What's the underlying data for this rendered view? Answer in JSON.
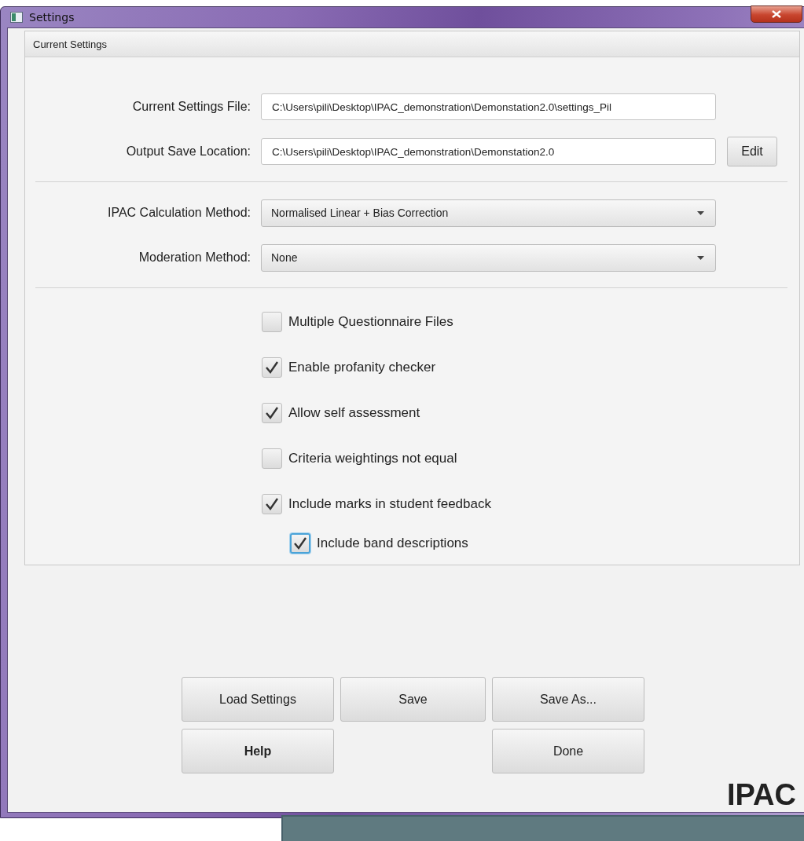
{
  "window": {
    "title": "Settings"
  },
  "panel": {
    "title": "Current Settings"
  },
  "file_fields": [
    {
      "label": "Current Settings File:",
      "value": "C:\\Users\\pili\\Desktop\\IPAC_demonstration\\Demonstation2.0\\settings_Pil"
    },
    {
      "label": "Output Save Location:",
      "value": "C:\\Users\\pili\\Desktop\\IPAC_demonstration\\Demonstation2.0",
      "button": "Edit"
    }
  ],
  "dropdowns": [
    {
      "label": "IPAC Calculation Method:",
      "value": "Normalised Linear + Bias Correction"
    },
    {
      "label": "Moderation Method:",
      "value": "None"
    }
  ],
  "options": [
    {
      "label": "Multiple Questionnaire Files",
      "checked": false,
      "focused": false
    },
    {
      "label": "Enable profanity checker",
      "checked": true,
      "focused": false
    },
    {
      "label": "Allow self assessment",
      "checked": true,
      "focused": false
    },
    {
      "label": "Criteria weightings not equal",
      "checked": false,
      "focused": false
    },
    {
      "label": "Include marks in student feedback",
      "checked": true,
      "focused": false,
      "children": [
        {
          "label": "Include band descriptions",
          "checked": true,
          "focused": true
        }
      ]
    }
  ],
  "buttons": [
    {
      "label": "Load Settings",
      "default": false
    },
    {
      "label": "Save",
      "default": false
    },
    {
      "label": "Save As...",
      "default": false
    },
    {
      "label": "Help",
      "default": true
    },
    {
      "label": "Done",
      "default": false
    }
  ],
  "logo": "IPAC"
}
